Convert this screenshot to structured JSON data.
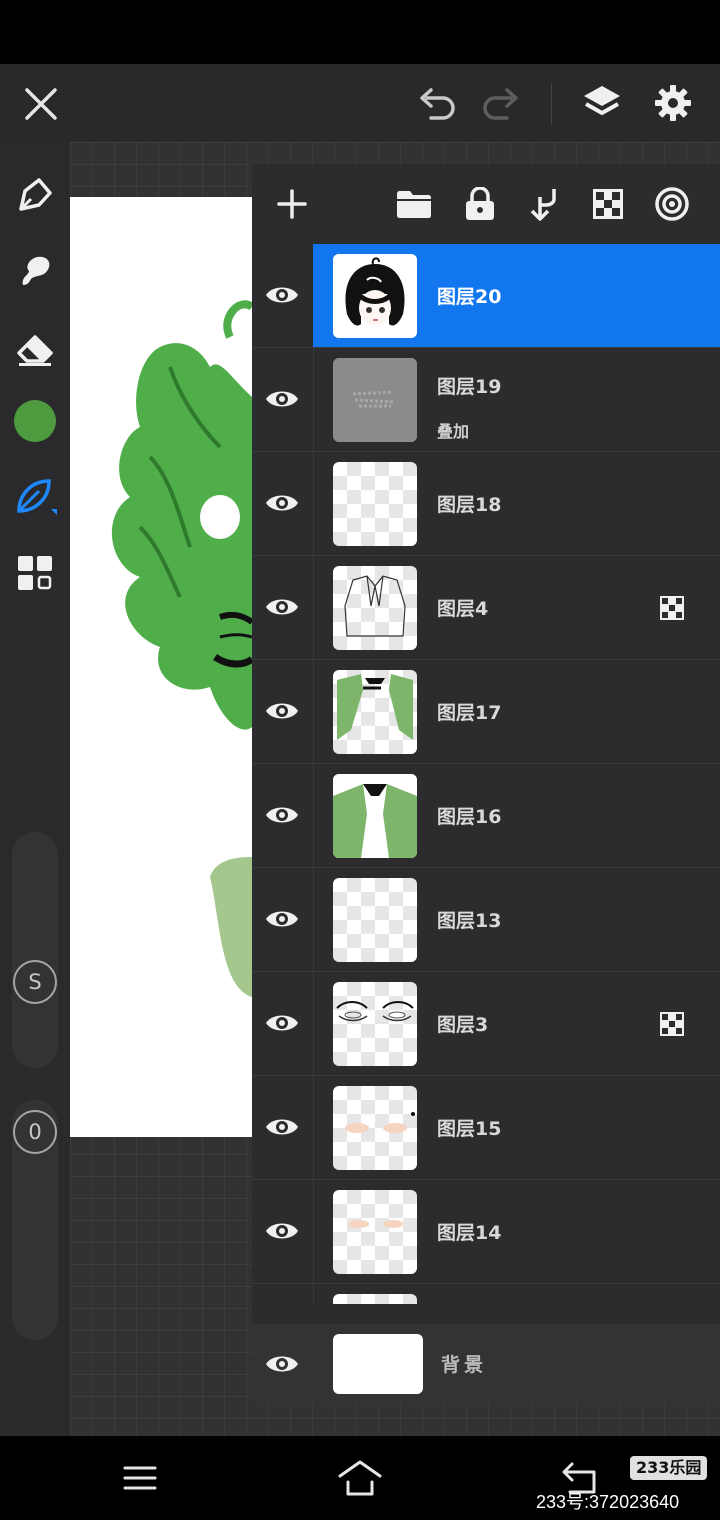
{
  "topbar": {
    "close_icon": "close-icon",
    "undo_icon": "undo-icon",
    "redo_icon": "redo-icon",
    "layers_icon": "layers-icon",
    "settings_icon": "gear-icon"
  },
  "sidebar": {
    "tools": [
      "pen-tool-icon",
      "smudge-tool-icon",
      "eraser-tool-icon",
      "color-swatch",
      "brush-icon",
      "grid-menu-icon"
    ],
    "current_color": "#4e9a3e",
    "size_label": "S",
    "opacity_label": "0"
  },
  "layer_toolbar": [
    "add-icon",
    "folder-icon",
    "lock-icon",
    "merge-down-icon",
    "alpha-lock-icon",
    "blend-target-icon"
  ],
  "layers": [
    {
      "name": "图层20",
      "mode": "",
      "selected": true,
      "alpha_lock": false,
      "thumb": "face"
    },
    {
      "name": "图层19",
      "mode": "叠加",
      "selected": false,
      "alpha_lock": false,
      "thumb": "gray"
    },
    {
      "name": "图层18",
      "mode": "",
      "selected": false,
      "alpha_lock": false,
      "thumb": "empty"
    },
    {
      "name": "图层4",
      "mode": "",
      "selected": false,
      "alpha_lock": true,
      "thumb": "shirt-lines"
    },
    {
      "name": "图层17",
      "mode": "",
      "selected": false,
      "alpha_lock": false,
      "thumb": "green-collar"
    },
    {
      "name": "图层16",
      "mode": "",
      "selected": false,
      "alpha_lock": false,
      "thumb": "green-jacket"
    },
    {
      "name": "图层13",
      "mode": "",
      "selected": false,
      "alpha_lock": false,
      "thumb": "empty"
    },
    {
      "name": "图层3",
      "mode": "",
      "selected": false,
      "alpha_lock": true,
      "thumb": "eyes"
    },
    {
      "name": "图层15",
      "mode": "",
      "selected": false,
      "alpha_lock": false,
      "thumb": "blush"
    },
    {
      "name": "图层14",
      "mode": "",
      "selected": false,
      "alpha_lock": false,
      "thumb": "blush"
    }
  ],
  "background_layer": {
    "name": "背景"
  },
  "navbar": {
    "menu_icon": "menu-icon",
    "home_icon": "home-icon",
    "back_icon": "back-icon"
  },
  "watermark": {
    "brand": "233乐园",
    "id_text": "233号:372023640"
  },
  "colors": {
    "accent": "#1277ee",
    "hair_green": "#4fae4a"
  }
}
